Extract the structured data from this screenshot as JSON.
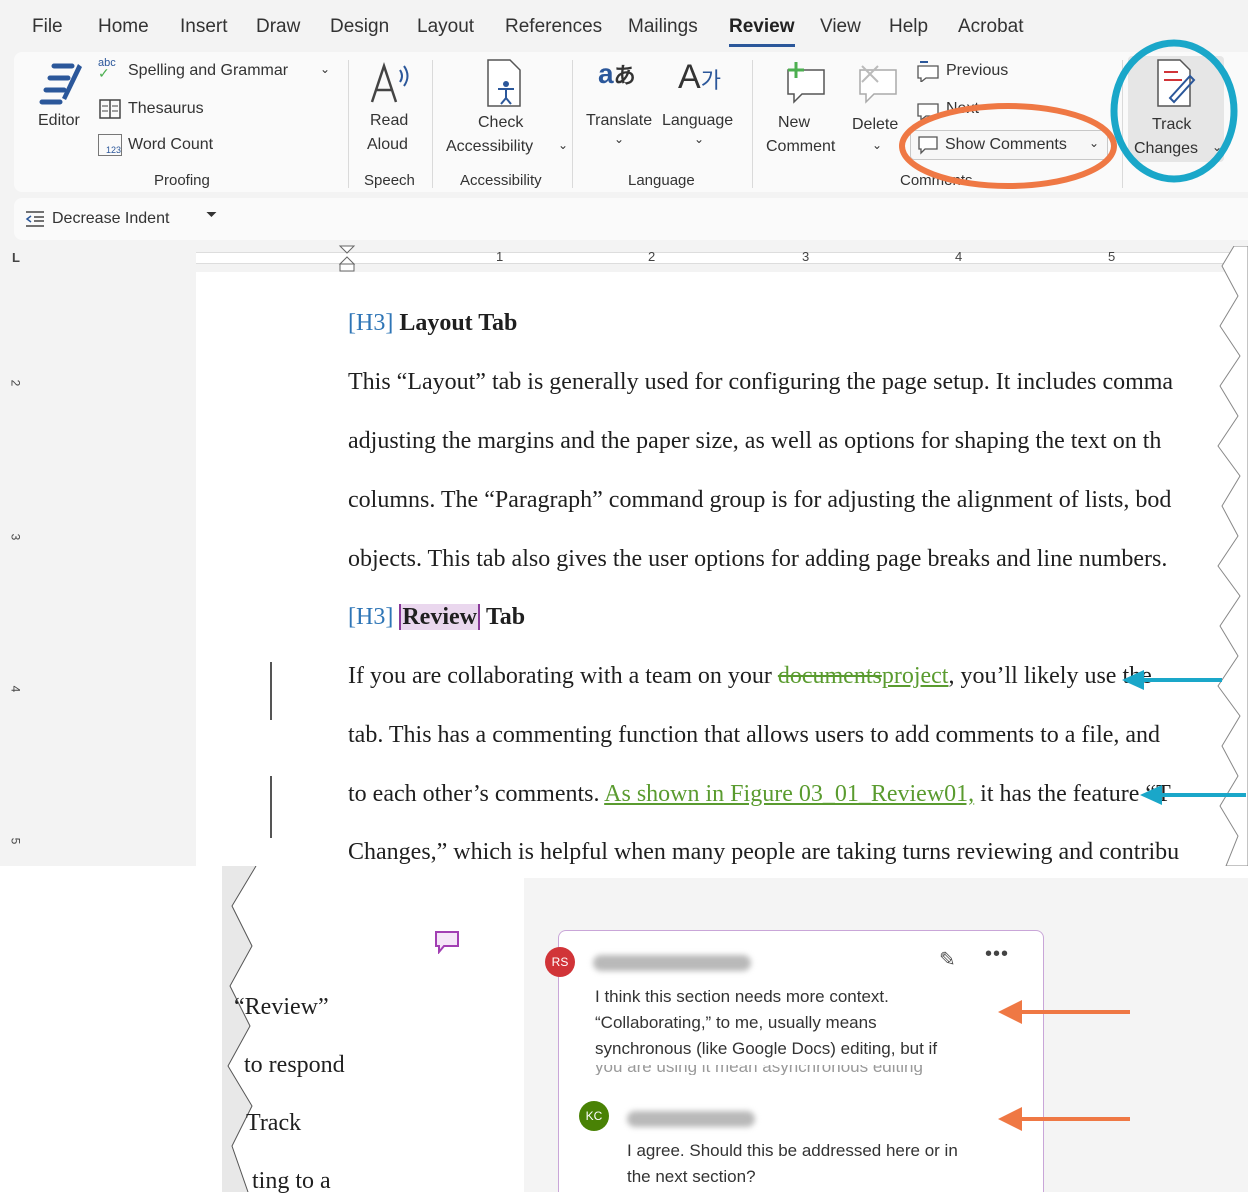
{
  "menu": {
    "tabs": [
      "File",
      "Home",
      "Insert",
      "Draw",
      "Design",
      "Layout",
      "References",
      "Mailings",
      "Review",
      "View",
      "Help",
      "Acrobat"
    ],
    "active": "Review"
  },
  "ribbon": {
    "editor": "Editor",
    "spelling": "Spelling and Grammar",
    "thesaurus": "Thesaurus",
    "word_count": "Word Count",
    "proofing": "Proofing",
    "read": "Read",
    "aloud": "Aloud",
    "speech": "Speech",
    "check": "Check",
    "accessibility_btn": "Accessibility",
    "accessibility_group": "Accessibility",
    "translate": "Translate",
    "language_btn": "Language",
    "language_group": "Language",
    "new": "New",
    "comment": "Comment",
    "delete": "Delete",
    "previous": "Previous",
    "next": "Next",
    "show_comments": "Show Comments",
    "comments_group": "Comments",
    "track": "Track",
    "changes": "Changes"
  },
  "qat": {
    "decrease_indent": "Decrease Indent"
  },
  "ruler": {
    "numbers": [
      "1",
      "2",
      "3",
      "4",
      "5"
    ],
    "vnumbers": [
      "2",
      "3",
      "4",
      "5"
    ]
  },
  "document": {
    "h3_tag": "[H3]",
    "layout_heading": "Layout Tab",
    "p1": [
      "This “Layout” tab is generally used for configuring the page setup. It includes comma",
      "adjusting the margins and the paper size, as well as options for shaping the text on th",
      "columns. The “Paragraph” command group is for adjusting the alignment of lists, bod",
      "objects. This tab also gives the user options for adding page breaks and line numbers."
    ],
    "review_word": "Review",
    "tab_word": "Tab",
    "p2_l1_a": "If you are collaborating with a team on your ",
    "p2_l1_del": "documents",
    "p2_l1_ins": "project",
    "p2_l1_b": ", you’ll likely use the",
    "p2_l2": "tab. This has a commenting function that allows users to add comments to a file, and ",
    "p2_l3_a": "to each other’s comments. ",
    "p2_l3_ins": "As shown in Figure 03_01_Review01,",
    "p2_l3_b": " it has the feature “T",
    "p2_l4": "Changes,” which is helpful when many people are taking turns reviewing and contribu"
  },
  "fragments": [
    "“Review”",
    "to respond",
    "Track",
    "ting to a"
  ],
  "comments": [
    {
      "initials": "RS",
      "avatar_color": "#d13438",
      "lines": [
        "I think this section needs more context.",
        "“Collaborating,” to me, usually means",
        "synchronous (like Google Docs) editing, but if",
        "you are using it mean asynchronous editing"
      ]
    },
    {
      "initials": "KC",
      "avatar_color": "#498205",
      "lines": [
        "I agree. Should this be addressed here or in",
        "the next section?"
      ]
    }
  ],
  "colors": {
    "accent": "#2b579a",
    "cyan": "#1aa7c9",
    "orange": "#ef7844",
    "track_green": "#5a9b2f",
    "heading_blue": "#2e75b6"
  }
}
